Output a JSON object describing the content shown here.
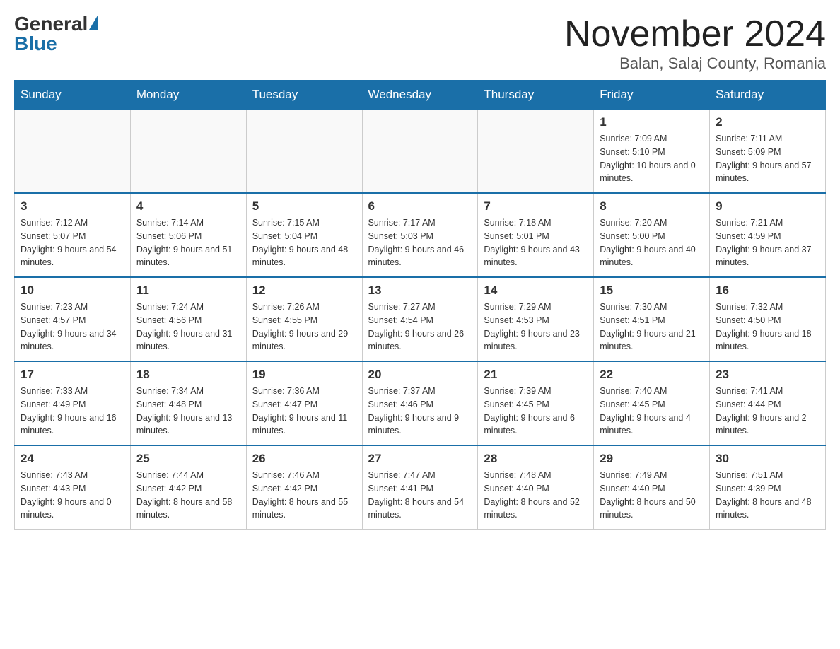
{
  "header": {
    "logo_general": "General",
    "logo_blue": "Blue",
    "month_title": "November 2024",
    "location": "Balan, Salaj County, Romania"
  },
  "days_of_week": [
    "Sunday",
    "Monday",
    "Tuesday",
    "Wednesday",
    "Thursday",
    "Friday",
    "Saturday"
  ],
  "weeks": [
    {
      "days": [
        {
          "num": "",
          "empty": true
        },
        {
          "num": "",
          "empty": true
        },
        {
          "num": "",
          "empty": true
        },
        {
          "num": "",
          "empty": true
        },
        {
          "num": "",
          "empty": true
        },
        {
          "num": "1",
          "sunrise": "Sunrise: 7:09 AM",
          "sunset": "Sunset: 5:10 PM",
          "daylight": "Daylight: 10 hours and 0 minutes."
        },
        {
          "num": "2",
          "sunrise": "Sunrise: 7:11 AM",
          "sunset": "Sunset: 5:09 PM",
          "daylight": "Daylight: 9 hours and 57 minutes."
        }
      ]
    },
    {
      "days": [
        {
          "num": "3",
          "sunrise": "Sunrise: 7:12 AM",
          "sunset": "Sunset: 5:07 PM",
          "daylight": "Daylight: 9 hours and 54 minutes."
        },
        {
          "num": "4",
          "sunrise": "Sunrise: 7:14 AM",
          "sunset": "Sunset: 5:06 PM",
          "daylight": "Daylight: 9 hours and 51 minutes."
        },
        {
          "num": "5",
          "sunrise": "Sunrise: 7:15 AM",
          "sunset": "Sunset: 5:04 PM",
          "daylight": "Daylight: 9 hours and 48 minutes."
        },
        {
          "num": "6",
          "sunrise": "Sunrise: 7:17 AM",
          "sunset": "Sunset: 5:03 PM",
          "daylight": "Daylight: 9 hours and 46 minutes."
        },
        {
          "num": "7",
          "sunrise": "Sunrise: 7:18 AM",
          "sunset": "Sunset: 5:01 PM",
          "daylight": "Daylight: 9 hours and 43 minutes."
        },
        {
          "num": "8",
          "sunrise": "Sunrise: 7:20 AM",
          "sunset": "Sunset: 5:00 PM",
          "daylight": "Daylight: 9 hours and 40 minutes."
        },
        {
          "num": "9",
          "sunrise": "Sunrise: 7:21 AM",
          "sunset": "Sunset: 4:59 PM",
          "daylight": "Daylight: 9 hours and 37 minutes."
        }
      ]
    },
    {
      "days": [
        {
          "num": "10",
          "sunrise": "Sunrise: 7:23 AM",
          "sunset": "Sunset: 4:57 PM",
          "daylight": "Daylight: 9 hours and 34 minutes."
        },
        {
          "num": "11",
          "sunrise": "Sunrise: 7:24 AM",
          "sunset": "Sunset: 4:56 PM",
          "daylight": "Daylight: 9 hours and 31 minutes."
        },
        {
          "num": "12",
          "sunrise": "Sunrise: 7:26 AM",
          "sunset": "Sunset: 4:55 PM",
          "daylight": "Daylight: 9 hours and 29 minutes."
        },
        {
          "num": "13",
          "sunrise": "Sunrise: 7:27 AM",
          "sunset": "Sunset: 4:54 PM",
          "daylight": "Daylight: 9 hours and 26 minutes."
        },
        {
          "num": "14",
          "sunrise": "Sunrise: 7:29 AM",
          "sunset": "Sunset: 4:53 PM",
          "daylight": "Daylight: 9 hours and 23 minutes."
        },
        {
          "num": "15",
          "sunrise": "Sunrise: 7:30 AM",
          "sunset": "Sunset: 4:51 PM",
          "daylight": "Daylight: 9 hours and 21 minutes."
        },
        {
          "num": "16",
          "sunrise": "Sunrise: 7:32 AM",
          "sunset": "Sunset: 4:50 PM",
          "daylight": "Daylight: 9 hours and 18 minutes."
        }
      ]
    },
    {
      "days": [
        {
          "num": "17",
          "sunrise": "Sunrise: 7:33 AM",
          "sunset": "Sunset: 4:49 PM",
          "daylight": "Daylight: 9 hours and 16 minutes."
        },
        {
          "num": "18",
          "sunrise": "Sunrise: 7:34 AM",
          "sunset": "Sunset: 4:48 PM",
          "daylight": "Daylight: 9 hours and 13 minutes."
        },
        {
          "num": "19",
          "sunrise": "Sunrise: 7:36 AM",
          "sunset": "Sunset: 4:47 PM",
          "daylight": "Daylight: 9 hours and 11 minutes."
        },
        {
          "num": "20",
          "sunrise": "Sunrise: 7:37 AM",
          "sunset": "Sunset: 4:46 PM",
          "daylight": "Daylight: 9 hours and 9 minutes."
        },
        {
          "num": "21",
          "sunrise": "Sunrise: 7:39 AM",
          "sunset": "Sunset: 4:45 PM",
          "daylight": "Daylight: 9 hours and 6 minutes."
        },
        {
          "num": "22",
          "sunrise": "Sunrise: 7:40 AM",
          "sunset": "Sunset: 4:45 PM",
          "daylight": "Daylight: 9 hours and 4 minutes."
        },
        {
          "num": "23",
          "sunrise": "Sunrise: 7:41 AM",
          "sunset": "Sunset: 4:44 PM",
          "daylight": "Daylight: 9 hours and 2 minutes."
        }
      ]
    },
    {
      "days": [
        {
          "num": "24",
          "sunrise": "Sunrise: 7:43 AM",
          "sunset": "Sunset: 4:43 PM",
          "daylight": "Daylight: 9 hours and 0 minutes."
        },
        {
          "num": "25",
          "sunrise": "Sunrise: 7:44 AM",
          "sunset": "Sunset: 4:42 PM",
          "daylight": "Daylight: 8 hours and 58 minutes."
        },
        {
          "num": "26",
          "sunrise": "Sunrise: 7:46 AM",
          "sunset": "Sunset: 4:42 PM",
          "daylight": "Daylight: 8 hours and 55 minutes."
        },
        {
          "num": "27",
          "sunrise": "Sunrise: 7:47 AM",
          "sunset": "Sunset: 4:41 PM",
          "daylight": "Daylight: 8 hours and 54 minutes."
        },
        {
          "num": "28",
          "sunrise": "Sunrise: 7:48 AM",
          "sunset": "Sunset: 4:40 PM",
          "daylight": "Daylight: 8 hours and 52 minutes."
        },
        {
          "num": "29",
          "sunrise": "Sunrise: 7:49 AM",
          "sunset": "Sunset: 4:40 PM",
          "daylight": "Daylight: 8 hours and 50 minutes."
        },
        {
          "num": "30",
          "sunrise": "Sunrise: 7:51 AM",
          "sunset": "Sunset: 4:39 PM",
          "daylight": "Daylight: 8 hours and 48 minutes."
        }
      ]
    }
  ]
}
